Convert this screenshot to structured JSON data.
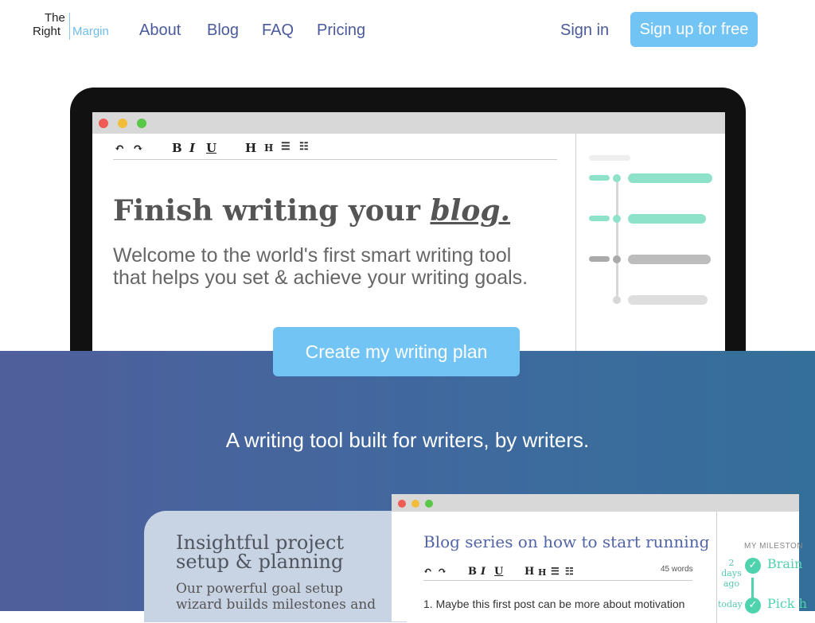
{
  "brand": {
    "line1": "The",
    "line2": "Right",
    "line3": "Margin"
  },
  "nav": {
    "about": "About",
    "blog": "Blog",
    "faq": "FAQ",
    "pricing": "Pricing"
  },
  "auth": {
    "signin": "Sign in",
    "signup": "Sign up for free"
  },
  "hero": {
    "heading_prefix": "Finish writing your ",
    "heading_emphasis": "blog.",
    "subtext": "Welcome to the world's first smart writing tool that helps you set & achieve your writing goals.",
    "toolbar": {
      "undo": "↶",
      "redo": "↷",
      "bold": "B",
      "italic": "I",
      "underline": "U",
      "h1": "H",
      "h2": "H",
      "bullets": "☰",
      "numbered": "☷"
    }
  },
  "cta": {
    "label": "Create my writing plan"
  },
  "section2": {
    "tagline": "A writing tool built for writers, by writers.",
    "card_title": "Insightful project setup & planning",
    "card_desc": "Our powerful goal setup wizard builds milestones and",
    "doc_title": "Blog series on how to start running",
    "word_count": "45 words",
    "doc_line": "1. Maybe this first post can be more about motivation",
    "milestones_label": "MY MILESTON",
    "ago_label": "2 days ago",
    "today_label": "today",
    "milestone1": "Brain",
    "milestone2": "Pick h"
  },
  "colors": {
    "accent": "#72c4f5",
    "nav": "#4a5a9c",
    "teal": "#4fd2ae",
    "blue_section": "#4a629e"
  }
}
